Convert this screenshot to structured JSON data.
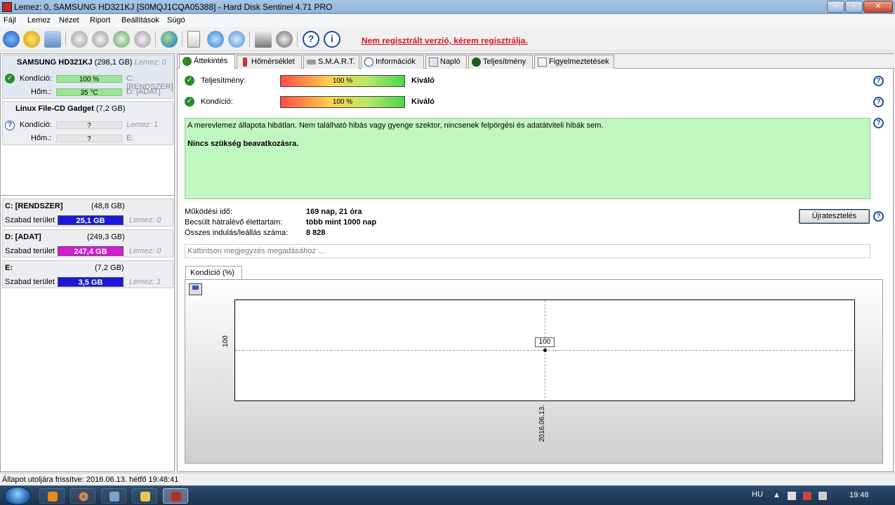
{
  "window": {
    "title": "Lemez: 0, SAMSUNG HD321KJ [S0MQJ1CQA05388]  -  Hard Disk Sentinel 4.71 PRO"
  },
  "menu": [
    "Fájl",
    "Lemez",
    "Nézet",
    "Riport",
    "Beállítások",
    "Súgó"
  ],
  "toolbar": {
    "register_text": "Nem regisztrált verzió, kérem regisztrálja."
  },
  "disks": [
    {
      "name": "SAMSUNG HD321KJ",
      "size": "(298,1 GB)",
      "index": "Lemez: 0",
      "condition_label": "Kondíció:",
      "condition": "100 %",
      "temp_label": "Hőm.:",
      "temp": "35 °C",
      "vol1": "C: [RENDSZER]",
      "vol2": "D: [ADAT]"
    },
    {
      "name": "Linux   File-CD Gadget",
      "size": "(7,2 GB)",
      "index": "Lemez: 1",
      "condition_label": "Kondíció:",
      "condition": "?",
      "temp_label": "Hőm.:",
      "temp": "?",
      "vol1": "E:"
    }
  ],
  "partitions": [
    {
      "name": "C: [RENDSZER]",
      "size": "(48,8 GB)",
      "free_label": "Szabad terület",
      "free": "25,1 GB",
      "disk": "Lemez: 0",
      "color": "#1a1ad6"
    },
    {
      "name": "D: [ADAT]",
      "size": "(249,3 GB)",
      "free_label": "Szabad terület",
      "free": "247,4 GB",
      "disk": "Lemez: 0",
      "color": "#d61ad6"
    },
    {
      "name": "E:",
      "size": "(7,2 GB)",
      "free_label": "Szabad terület",
      "free": "3,5 GB",
      "disk": "Lemez: 1",
      "color": "#1a1ad6"
    }
  ],
  "tabs": [
    "Áttekintés",
    "Hőmérséklet",
    "S.M.A.R.T.",
    "Információk",
    "Napló",
    "Teljesítmény",
    "Figyelmeztetések"
  ],
  "overview": {
    "performance_label": "Teljesítmény:",
    "performance_value": "100 %",
    "performance_rating": "Kiváló",
    "condition_label": "Kondíció:",
    "condition_value": "100 %",
    "condition_rating": "Kiváló",
    "summary_line1": "A merevlemez állapota hibátlan. Nem található hibás vagy gyenge szektor, nincsenek felpörgési és adatátviteli hibák sem.",
    "summary_line2": "Nincs szükség beavatkozásra.",
    "uptime_label": "Működési idő:",
    "uptime_value": "169 nap, 21 óra",
    "lifetime_label": "Becsült hátralévő élettartam:",
    "lifetime_value": "több mint 1000 nap",
    "starts_label": "Összes indulás/leállás száma:",
    "starts_value": "8 828",
    "retest_label": "Újratesztelés",
    "note_placeholder": "Kattintson megjegyzés megadásához ..."
  },
  "chart_tab": "Kondíció  (%)",
  "chart_data": {
    "type": "line",
    "x": [
      "2016.06.13."
    ],
    "series": [
      {
        "values": [
          100
        ]
      }
    ],
    "y_tick_labels": [
      "100"
    ],
    "data_labels": [
      "100"
    ],
    "grid": true
  },
  "statusbar": {
    "text": "Állapot utoljára frissítve: 2016.06.13. hétfő 19:48:41"
  },
  "taskbar": {
    "lang": "HU",
    "clock": "19:48"
  }
}
